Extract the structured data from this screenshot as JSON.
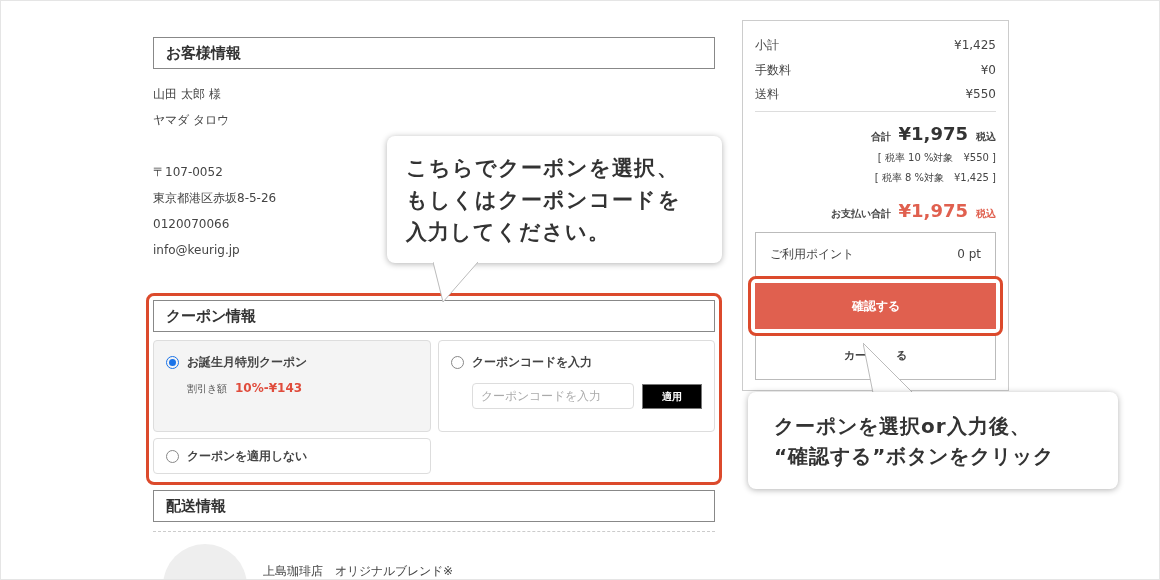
{
  "customer": {
    "heading": "お客様情報",
    "name_lines": [
      "山田 太郎 様",
      "ヤマダ タロウ"
    ],
    "address_lines": [
      "〒107-0052",
      "東京都港区赤坂8-5-26",
      "0120070066",
      "info@keurig.jp"
    ]
  },
  "coupon": {
    "heading": "クーポン情報",
    "options": [
      {
        "kind": "birthday",
        "label": "お誕生月特別クーポン",
        "selected": true,
        "discount_label": "割引き額",
        "discount_value": "10%-¥143"
      },
      {
        "kind": "code",
        "label": "クーポンコードを入力",
        "selected": false,
        "placeholder": "クーポンコードを入力",
        "apply_button": "適用"
      },
      {
        "kind": "none",
        "label": "クーポンを適用しない",
        "selected": false
      }
    ]
  },
  "delivery": {
    "heading": "配送情報",
    "product_name": "上島珈琲店　オリジナルブレンド※"
  },
  "summary": {
    "rows": [
      {
        "label": "小計",
        "value": "¥1,425"
      },
      {
        "label": "手数料",
        "value": "¥0"
      },
      {
        "label": "送料",
        "value": "¥550"
      }
    ],
    "total_label": "合計",
    "total_value": "¥1,975",
    "total_tax": "税込",
    "tax_breakdown": [
      "[ 税率 10 %対象　¥550 ]",
      "[ 税率 8 %対象　¥1,425 ]"
    ],
    "pay_label": "お支払い合計",
    "pay_value": "¥1,975",
    "pay_tax": "税込",
    "points_label": "ご利用ポイント",
    "points_value": "0 pt",
    "confirm_button": "確認する",
    "cart_button_parts": [
      "カー",
      "る"
    ]
  },
  "callouts": [
    {
      "lines": [
        "こちらでクーポンを選択、",
        "もしくはクーポンコードを",
        "入力してください。"
      ]
    },
    {
      "lines": [
        "クーポンを選択or入力後、",
        "“確認する”ボタンをクリック"
      ]
    }
  ]
}
